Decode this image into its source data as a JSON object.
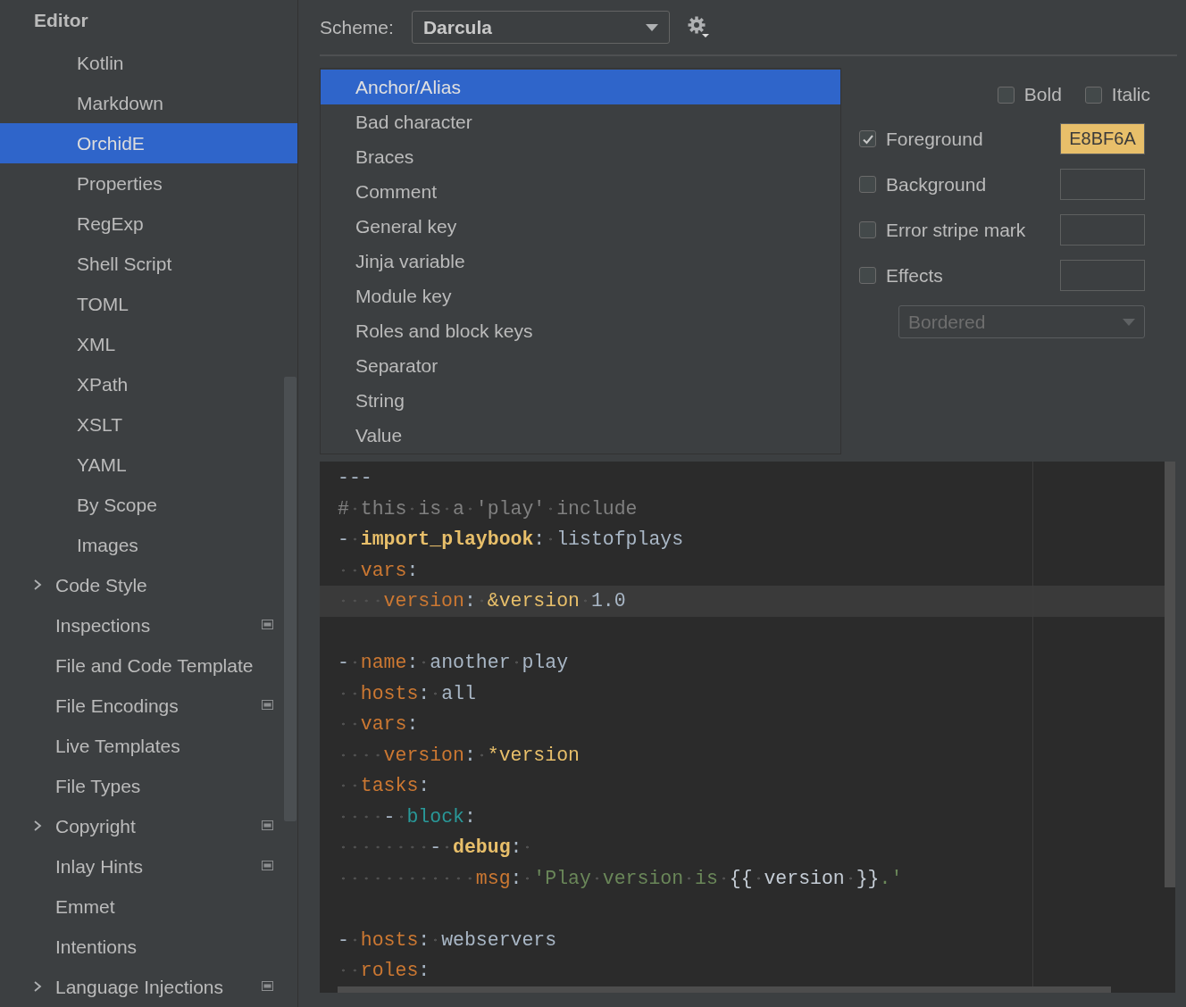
{
  "sidebar": {
    "heading": "Editor",
    "items": [
      {
        "children": [
          {
            "label": "Kotlin",
            "kind": "leaf",
            "selected": false,
            "project_icon": false
          },
          {
            "label": "Markdown",
            "kind": "leaf",
            "selected": false,
            "project_icon": false
          },
          {
            "label": "OrchidE",
            "kind": "leaf",
            "selected": true,
            "project_icon": false
          },
          {
            "label": "Properties",
            "kind": "leaf",
            "selected": false,
            "project_icon": false
          },
          {
            "label": "RegExp",
            "kind": "leaf",
            "selected": false,
            "project_icon": false
          },
          {
            "label": "Shell Script",
            "kind": "leaf",
            "selected": false,
            "project_icon": false
          },
          {
            "label": "TOML",
            "kind": "leaf",
            "selected": false,
            "project_icon": false
          },
          {
            "label": "XML",
            "kind": "leaf",
            "selected": false,
            "project_icon": false
          },
          {
            "label": "XPath",
            "kind": "leaf",
            "selected": false,
            "project_icon": false
          },
          {
            "label": "XSLT",
            "kind": "leaf",
            "selected": false,
            "project_icon": false
          },
          {
            "label": "YAML",
            "kind": "leaf",
            "selected": false,
            "project_icon": false
          },
          {
            "label": "By Scope",
            "kind": "leaf",
            "selected": false,
            "project_icon": false
          },
          {
            "label": "Images",
            "kind": "leaf",
            "selected": false,
            "project_icon": false
          }
        ]
      },
      {
        "label": "Code Style",
        "kind": "node",
        "selected": false,
        "project_icon": false
      },
      {
        "label": "Inspections",
        "kind": "leaf",
        "selected": false,
        "project_icon": true
      },
      {
        "label": "File and Code Template",
        "kind": "leaf",
        "selected": false,
        "project_icon": false
      },
      {
        "label": "File Encodings",
        "kind": "leaf",
        "selected": false,
        "project_icon": true
      },
      {
        "label": "Live Templates",
        "kind": "leaf",
        "selected": false,
        "project_icon": false
      },
      {
        "label": "File Types",
        "kind": "leaf",
        "selected": false,
        "project_icon": false
      },
      {
        "label": "Copyright",
        "kind": "node",
        "selected": false,
        "project_icon": true
      },
      {
        "label": "Inlay Hints",
        "kind": "leaf",
        "selected": false,
        "project_icon": true
      },
      {
        "label": "Emmet",
        "kind": "leaf",
        "selected": false,
        "project_icon": false
      },
      {
        "label": "Intentions",
        "kind": "leaf",
        "selected": false,
        "project_icon": false
      },
      {
        "label": "Language Injections",
        "kind": "node",
        "selected": false,
        "project_icon": true
      }
    ]
  },
  "scheme": {
    "label": "Scheme:",
    "value": "Darcula"
  },
  "elements": [
    {
      "label": "Anchor/Alias",
      "selected": true
    },
    {
      "label": "Bad character",
      "selected": false
    },
    {
      "label": "Braces",
      "selected": false
    },
    {
      "label": "Comment",
      "selected": false
    },
    {
      "label": "General key",
      "selected": false
    },
    {
      "label": "Jinja variable",
      "selected": false
    },
    {
      "label": "Module key",
      "selected": false
    },
    {
      "label": "Roles and block keys",
      "selected": false
    },
    {
      "label": "Separator",
      "selected": false
    },
    {
      "label": "String",
      "selected": false
    },
    {
      "label": "Value",
      "selected": false
    }
  ],
  "attributes": {
    "bold": {
      "label": "Bold",
      "checked": false
    },
    "italic": {
      "label": "Italic",
      "checked": false
    },
    "rows": [
      {
        "label": "Foreground",
        "checked": true,
        "value": "E8BF6A",
        "color": "#e8bf6a"
      },
      {
        "label": "Background",
        "checked": false
      },
      {
        "label": "Error stripe mark",
        "checked": false
      },
      {
        "label": "Effects",
        "checked": false
      }
    ],
    "effect": {
      "value": "Bordered",
      "disabled": true
    }
  },
  "preview": {
    "lines": [
      {
        "current": false,
        "tokens": [
          {
            "kind": "plain",
            "text": "---"
          }
        ]
      },
      {
        "current": false,
        "tokens": [
          {
            "kind": "comment",
            "text": "# this is a 'play' include"
          }
        ]
      },
      {
        "current": false,
        "tokens": [
          {
            "kind": "plain",
            "text": "- "
          },
          {
            "kind": "bold-key",
            "text": "import_playbook"
          },
          {
            "kind": "plain",
            "text": ": "
          },
          {
            "kind": "scalar",
            "text": "listofplays"
          }
        ]
      },
      {
        "current": false,
        "tokens": [
          {
            "kind": "key",
            "text": "  vars"
          },
          {
            "kind": "plain",
            "text": ":"
          }
        ]
      },
      {
        "current": true,
        "tokens": [
          {
            "kind": "key",
            "text": "    version"
          },
          {
            "kind": "plain",
            "text": ": "
          },
          {
            "kind": "anchor",
            "text": "&version"
          },
          {
            "kind": "scalar",
            "text": " 1.0"
          }
        ]
      },
      {
        "current": false
      },
      {
        "current": false,
        "tokens": [
          {
            "kind": "plain",
            "text": "- "
          },
          {
            "kind": "key",
            "text": "name"
          },
          {
            "kind": "plain",
            "text": ": "
          },
          {
            "kind": "scalar",
            "text": "another play"
          }
        ]
      },
      {
        "current": false,
        "tokens": [
          {
            "kind": "key",
            "text": "  hosts"
          },
          {
            "kind": "plain",
            "text": ": "
          },
          {
            "kind": "scalar",
            "text": "all"
          }
        ]
      },
      {
        "current": false,
        "tokens": [
          {
            "kind": "key",
            "text": "  vars"
          },
          {
            "kind": "plain",
            "text": ":"
          }
        ]
      },
      {
        "current": false,
        "tokens": [
          {
            "kind": "key",
            "text": "    version"
          },
          {
            "kind": "plain",
            "text": ": "
          },
          {
            "kind": "anchor",
            "text": "*version"
          }
        ]
      },
      {
        "current": false,
        "tokens": [
          {
            "kind": "key",
            "text": "  tasks"
          },
          {
            "kind": "plain",
            "text": ":"
          }
        ]
      },
      {
        "current": false,
        "tokens": [
          {
            "kind": "plain",
            "text": "    - "
          },
          {
            "kind": "block-key",
            "text": "block"
          },
          {
            "kind": "plain",
            "text": ":"
          }
        ]
      },
      {
        "current": false,
        "tokens": [
          {
            "kind": "plain",
            "text": "        - "
          },
          {
            "kind": "bold-key",
            "text": "debug"
          },
          {
            "kind": "plain",
            "text": ": "
          }
        ]
      },
      {
        "current": false,
        "tokens": [
          {
            "kind": "key",
            "text": "            msg"
          },
          {
            "kind": "plain",
            "text": ": "
          },
          {
            "kind": "string",
            "text": "'Play version is "
          },
          {
            "kind": "template",
            "text": "{{ version }}"
          },
          {
            "kind": "string",
            "text": ".'"
          }
        ]
      },
      {
        "current": false
      },
      {
        "current": false,
        "tokens": [
          {
            "kind": "plain",
            "text": "- "
          },
          {
            "kind": "key",
            "text": "hosts"
          },
          {
            "kind": "plain",
            "text": ": "
          },
          {
            "kind": "scalar",
            "text": "webservers"
          }
        ]
      },
      {
        "current": false,
        "tokens": [
          {
            "kind": "key",
            "text": "  roles"
          },
          {
            "kind": "plain",
            "text": ":"
          }
        ]
      }
    ]
  }
}
